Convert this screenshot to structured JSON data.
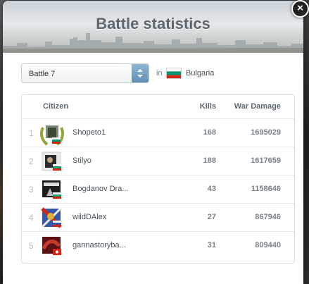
{
  "popup": {
    "title": "Battle statistics",
    "close_glyph": "×"
  },
  "filter": {
    "battle_label": "Battle 7",
    "in_label": "in",
    "country": "Bulgaria"
  },
  "table": {
    "headers": {
      "citizen": "Citizen",
      "kills": "Kills",
      "damage": "War Damage"
    },
    "rows": [
      {
        "rank": "1",
        "name": "Shopeto1",
        "kills": "168",
        "damage": "1695029"
      },
      {
        "rank": "2",
        "name": "Stilyo",
        "kills": "188",
        "damage": "1617659"
      },
      {
        "rank": "3",
        "name": "Bogdanov Dra...",
        "kills": "43",
        "damage": "1158646"
      },
      {
        "rank": "4",
        "name": "wildDAlex",
        "kills": "27",
        "damage": "867946"
      },
      {
        "rank": "5",
        "name": "gannastoryba...",
        "kills": "31",
        "damage": "809440"
      }
    ]
  },
  "icons": {
    "close": "close-icon",
    "dropdown": "dropdown-arrows-icon",
    "flag": "bulgaria-flag-icon",
    "laurel": "laurel-wreath-icon"
  },
  "colors": {
    "title": "#5d6770",
    "accent_blue": "#5f8fb5",
    "flag_white": "#ffffff",
    "flag_green": "#00966e",
    "flag_red": "#d62612"
  }
}
